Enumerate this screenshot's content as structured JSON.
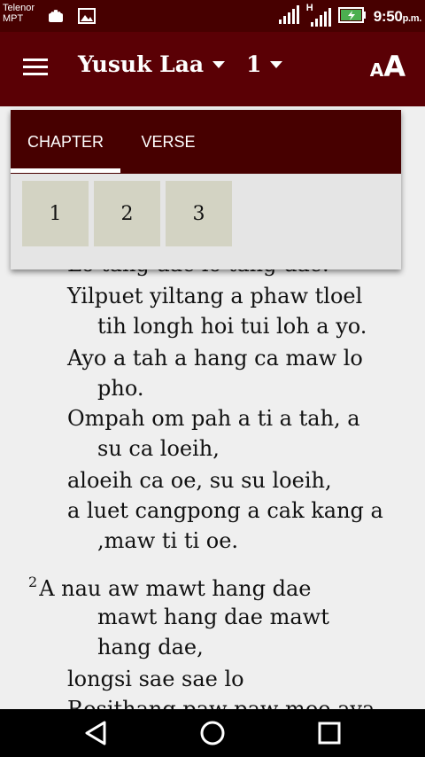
{
  "status_bar": {
    "carrier_line1": "Telenor",
    "carrier_line2": "MPT",
    "network_label": "H",
    "time": "9:50",
    "time_suffix": "p.m."
  },
  "app_bar": {
    "book": "Yusuk Laa",
    "chapter": "1",
    "font_size_small": "A",
    "font_size_large": "A"
  },
  "selector": {
    "tabs": [
      "CHAPTER",
      "VERSE"
    ],
    "active_tab": "CHAPTER",
    "chapters": [
      "1",
      "2",
      "3"
    ]
  },
  "reading": {
    "lines": [
      "Lo tang dae lo tang dae.",
      "Yilpuet yiltang a phaw tloel",
      "tih longh hoi tui loh a yo.",
      "Ayo a tah a hang ca maw lo",
      "pho.",
      "Ompah om pah a ti a tah, a",
      "su ca loeih,",
      "aloeih ca oe, su su loeih,",
      "a luet cangpong a cak kang a",
      ",maw ti ti oe.",
      "2",
      "A nau aw mawt hang dae",
      "mawt hang dae mawt",
      "hang dae,",
      "longsi sae sae lo",
      "Rosithang paw paw moe aya"
    ]
  },
  "colors": {
    "status_bar": "#470000",
    "app_bar": "#5a0005",
    "tab_bar": "#470000",
    "chapter_cell": "#d3d3c3",
    "background": "#efefef"
  }
}
